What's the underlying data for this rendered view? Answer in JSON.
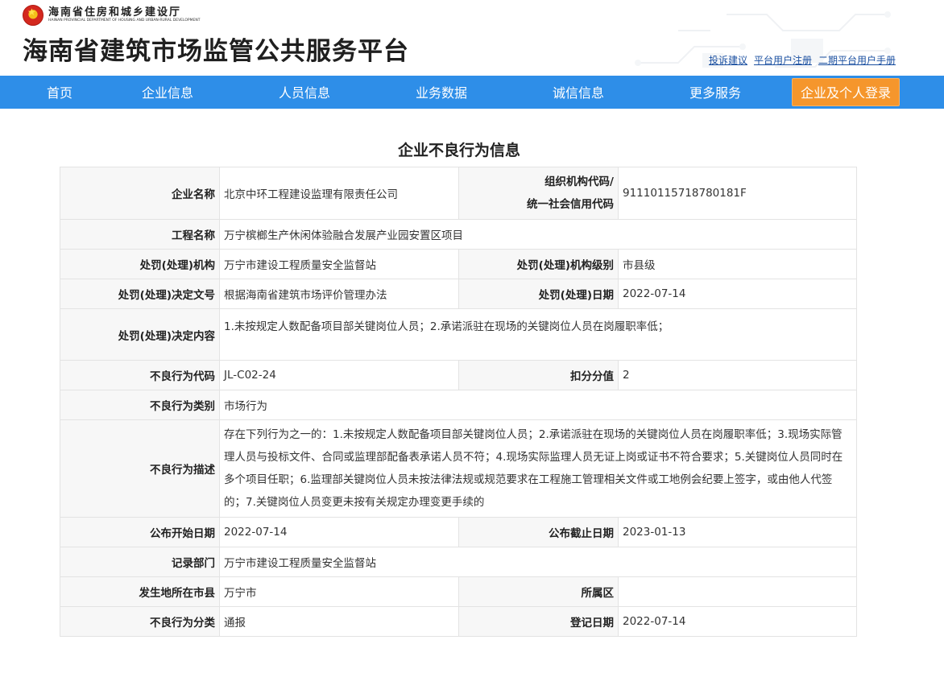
{
  "header": {
    "gov_name_cn": "海南省住房和城乡建设厅",
    "gov_name_en": "HAINAN PROVINCIAL DEPARTMENT OF HOUSING AND URBAN-RURAL DEVELOPMENT",
    "site_title": "海南省建筑市场监管公共服务平台",
    "links": [
      "投诉建议",
      "平台用户注册",
      "二期平台用户手册"
    ]
  },
  "nav": {
    "items": [
      "首页",
      "企业信息",
      "人员信息",
      "业务数据",
      "诚信信息",
      "更多服务"
    ],
    "login": "企业及个人登录"
  },
  "page_title": "企业不良行为信息",
  "info": {
    "company_name": {
      "label": "企业名称",
      "value": "北京中环工程建设监理有限责任公司"
    },
    "org_code": {
      "label_line1": "组织机构代码/",
      "label_line2": "统一社会信用代码",
      "value": "91110115718780181F"
    },
    "project_name": {
      "label": "工程名称",
      "value": "万宁槟榔生产休闲体验融合发展产业园安置区项目"
    },
    "penalty_org": {
      "label": "处罚(处理)机构",
      "value": "万宁市建设工程质量安全监督站"
    },
    "penalty_org_level": {
      "label": "处罚(处理)机构级别",
      "value": "市县级"
    },
    "decision_doc": {
      "label": "处罚(处理)决定文号",
      "value": "根据海南省建筑市场评价管理办法"
    },
    "decision_date": {
      "label": "处罚(处理)日期",
      "value": "2022-07-14"
    },
    "decision_content": {
      "label": "处罚(处理)决定内容",
      "value": "1.未按规定人数配备项目部关键岗位人员；2.承诺派驻在现场的关键岗位人员在岗履职率低；"
    },
    "behavior_code": {
      "label": "不良行为代码",
      "value": "JL-C02-24"
    },
    "deduction": {
      "label": "扣分分值",
      "value": "2"
    },
    "behavior_type": {
      "label": "不良行为类别",
      "value": "市场行为"
    },
    "behavior_desc": {
      "label": "不良行为描述",
      "value": "存在下列行为之一的：1.未按规定人数配备项目部关键岗位人员；2.承诺派驻在现场的关键岗位人员在岗履职率低；3.现场实际管理人员与投标文件、合同或监理部配备表承诺人员不符；4.现场实际监理人员无证上岗或证书不符合要求；5.关键岗位人员同时在多个项目任职；6.监理部关键岗位人员未按法律法规或规范要求在工程施工管理相关文件或工地例会纪要上签字，或由他人代签的；7.关键岗位人员变更未按有关规定办理变更手续的"
    },
    "publish_start": {
      "label": "公布开始日期",
      "value": "2022-07-14"
    },
    "publish_end": {
      "label": "公布截止日期",
      "value": "2023-01-13"
    },
    "record_dept": {
      "label": "记录部门",
      "value": "万宁市建设工程质量安全监督站"
    },
    "city": {
      "label": "发生地所在市县",
      "value": "万宁市"
    },
    "district": {
      "label": "所属区",
      "value": ""
    },
    "category": {
      "label": "不良行为分类",
      "value": "通报"
    },
    "register_date": {
      "label": "登记日期",
      "value": "2022-07-14"
    }
  }
}
